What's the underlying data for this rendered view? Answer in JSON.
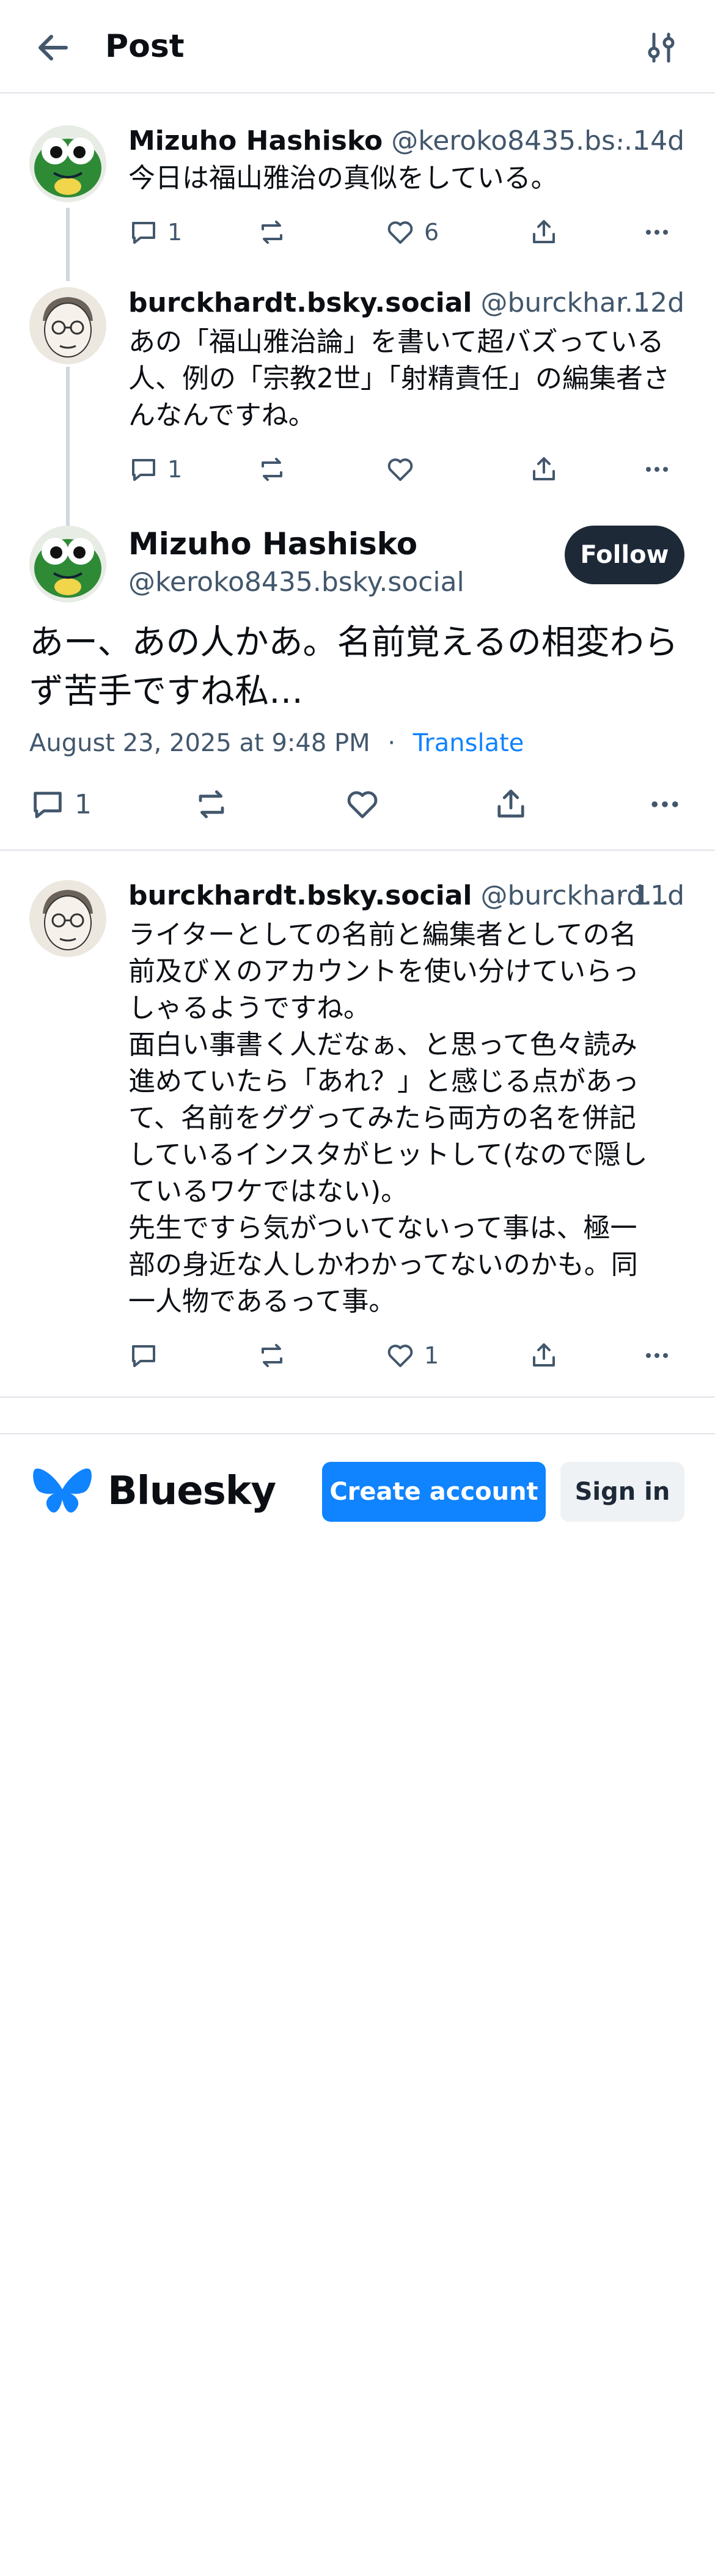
{
  "header": {
    "title": "Post"
  },
  "posts": [
    {
      "display_name": "Mizuho Hashisko",
      "handle": "@keroko8435.bs...",
      "time": "· 14d",
      "text": "今日は福山雅治の真似をしている。",
      "replies": "1",
      "reposts": "",
      "likes": "6"
    },
    {
      "display_name": "burckhardt.bsky.social",
      "handle": "@burckhar...",
      "time": "· 12d",
      "text": "あの「福山雅治論」を書いて超バズっている人、例の「宗教2世」「射精責任」の編集者さんなんですね。",
      "replies": "1",
      "reposts": "",
      "likes": ""
    }
  ],
  "main_post": {
    "display_name": "Mizuho Hashisko",
    "handle": "@keroko8435.bsky.social",
    "follow_label": "Follow",
    "text": "あー、あの人かあ。名前覚えるの相変わらず苦手ですね私…",
    "timestamp": "August 23, 2025 at 9:48 PM",
    "separator": "·",
    "translate_label": "Translate",
    "replies": "1"
  },
  "reply": {
    "display_name": "burckhardt.bsky.social",
    "handle": "@burckhard...",
    "time": "· 11d",
    "text_lines": [
      "ライターとしての名前と編集者としての名",
      "前及びＸのアカウントを使い分けていらっ",
      "しゃるようですね。",
      "面白い事書く人だなぁ、と思って色々読み",
      "進めていたら「あれ？」と感じる点があっ",
      "て、名前をググってみたら両方の名を併記",
      "しているインスタがヒットして(なので隠し",
      "ているワケではない)。",
      "先生ですら気がついてないって事は、極一",
      "部の身近な人しかわかってないのかも。同",
      "一人物であるって事。"
    ],
    "replies": "",
    "likes": "1"
  },
  "footer": {
    "brand": "Bluesky",
    "create_account": "Create account",
    "sign_in": "Sign in"
  },
  "colors": {
    "accent": "#1083fe",
    "muted": "#42576c",
    "follow_bg": "#1e2938",
    "divider": "#dfe3e8"
  },
  "icons": [
    "back-arrow-icon",
    "filter-sliders-icon",
    "reply-icon",
    "repost-icon",
    "like-icon",
    "share-icon",
    "more-icon",
    "butterfly-logo-icon"
  ]
}
